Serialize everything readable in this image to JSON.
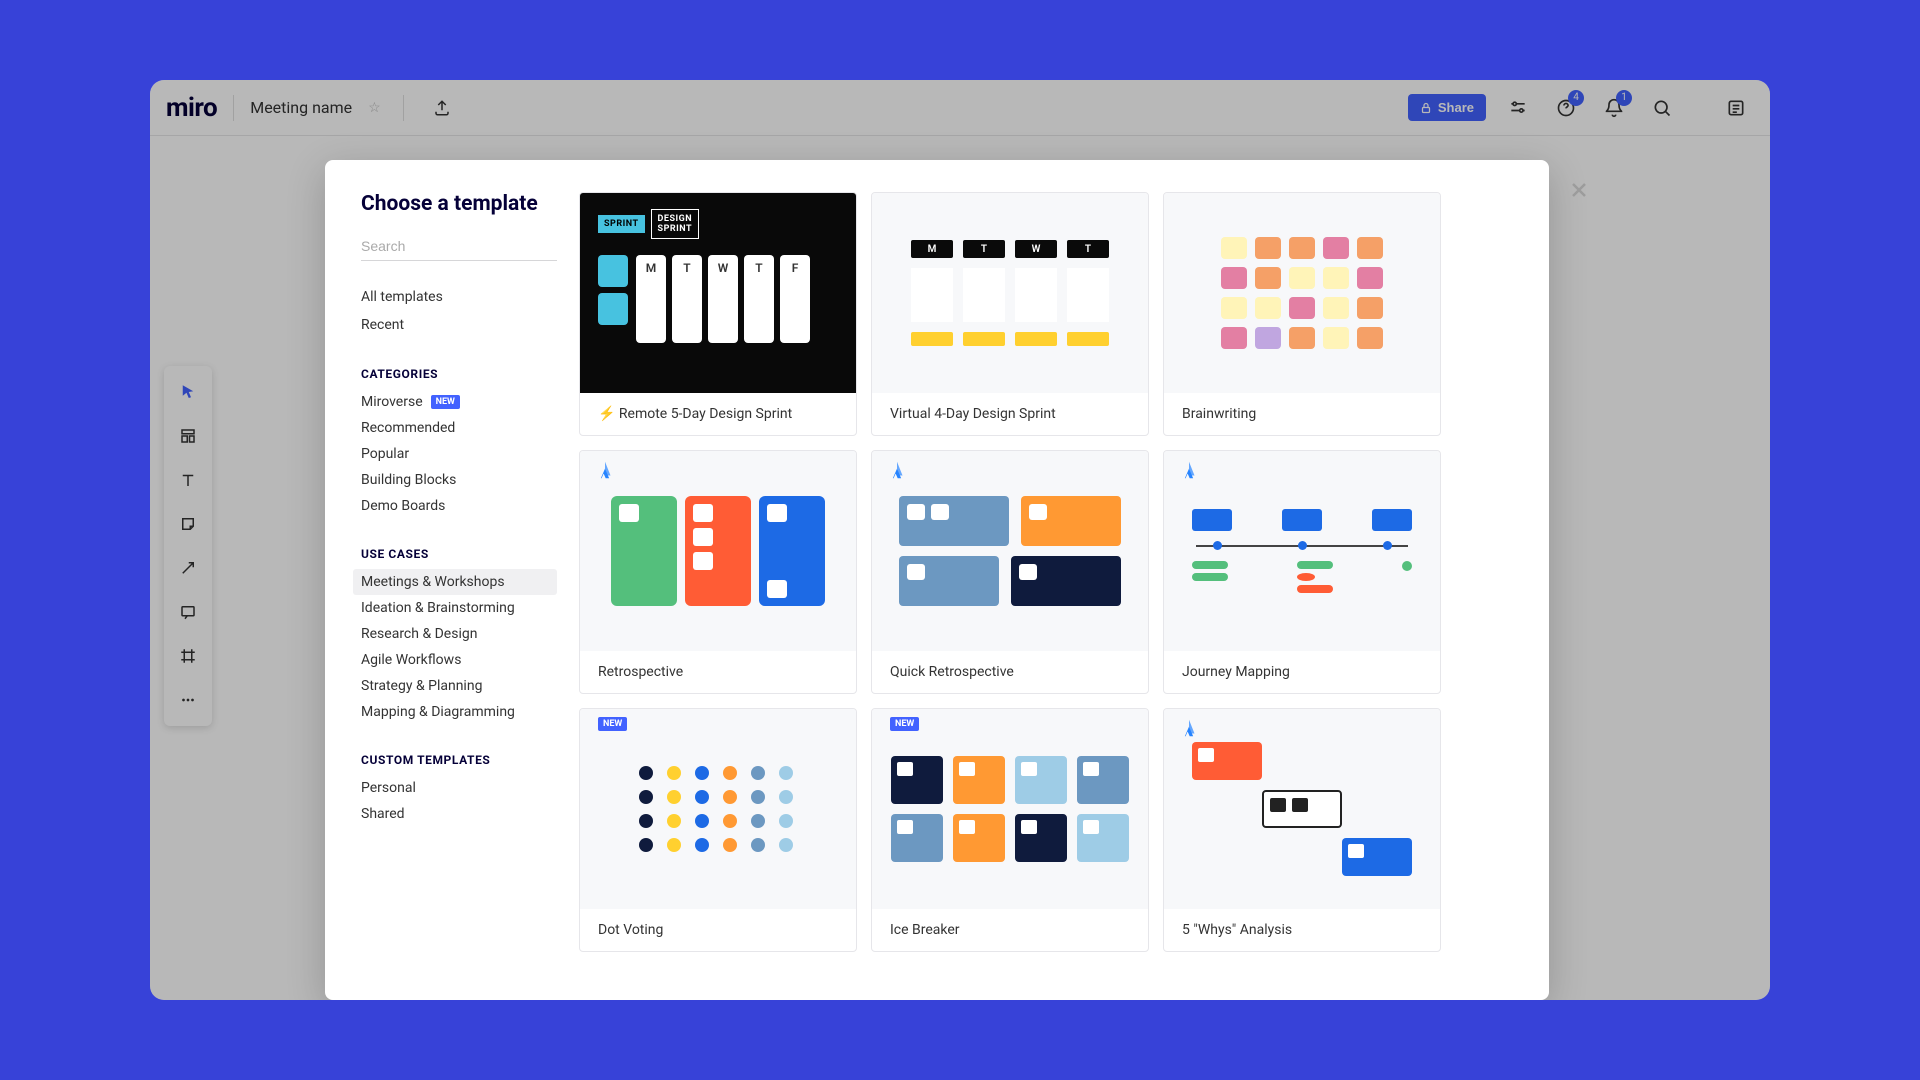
{
  "header": {
    "logo": "miro",
    "board_title": "Meeting name",
    "share_label": "Share",
    "comment_badge": "4",
    "notification_badge": "1"
  },
  "toolbar_tools": [
    "cursor",
    "templates",
    "text",
    "sticky",
    "arrow",
    "comment",
    "frame",
    "more"
  ],
  "modal": {
    "title": "Choose a template",
    "search_placeholder": "Search",
    "quick_links": [
      "All templates",
      "Recent"
    ],
    "section_categories_heading": "Categories",
    "categories": [
      {
        "label": "Miroverse",
        "badge": "NEW"
      },
      {
        "label": "Recommended"
      },
      {
        "label": "Popular"
      },
      {
        "label": "Building Blocks"
      },
      {
        "label": "Demo Boards"
      }
    ],
    "section_usecases_heading": "Use Cases",
    "usecases": [
      {
        "label": "Meetings & Workshops",
        "selected": true
      },
      {
        "label": "Ideation & Brainstorming"
      },
      {
        "label": "Research & Design"
      },
      {
        "label": "Agile Workflows"
      },
      {
        "label": "Strategy & Planning"
      },
      {
        "label": "Mapping & Diagramming"
      }
    ],
    "section_custom_heading": "Custom Templates",
    "custom": [
      {
        "label": "Personal"
      },
      {
        "label": "Shared"
      }
    ],
    "templates": [
      {
        "label": "⚡ Remote 5-Day Design Sprint",
        "preview": "sprint5d"
      },
      {
        "label": "Virtual 4-Day Design Sprint",
        "preview": "sprint4d"
      },
      {
        "label": "Brainwriting",
        "preview": "brainwriting"
      },
      {
        "label": "Retrospective",
        "preview": "retro",
        "atlassian": true
      },
      {
        "label": "Quick Retrospective",
        "preview": "qretro",
        "atlassian": true
      },
      {
        "label": "Journey Mapping",
        "preview": "journey",
        "atlassian": true
      },
      {
        "label": "Dot Voting",
        "preview": "dots",
        "new": true
      },
      {
        "label": "Ice Breaker",
        "preview": "ice",
        "new": true
      },
      {
        "label": "5 \"Whys\" Analysis",
        "preview": "whys",
        "atlassian": true
      }
    ]
  },
  "days5": [
    "M",
    "T",
    "W",
    "T",
    "F"
  ],
  "days4": [
    "M",
    "T",
    "W",
    "T"
  ],
  "new_label": "NEW",
  "colors": {
    "accent": "#4262ff",
    "teal": "#47c2e0",
    "yellow": "#ffd02f",
    "green": "#54bf7c",
    "orange": "#ff9933",
    "blue": "#1d6ae5",
    "navy": "#0f1b3d",
    "slate": "#6c98c1",
    "pink": "#e37fa3",
    "orange2": "#f5a067",
    "cream": "#fff4b8",
    "lav": "#c0a6e0"
  }
}
